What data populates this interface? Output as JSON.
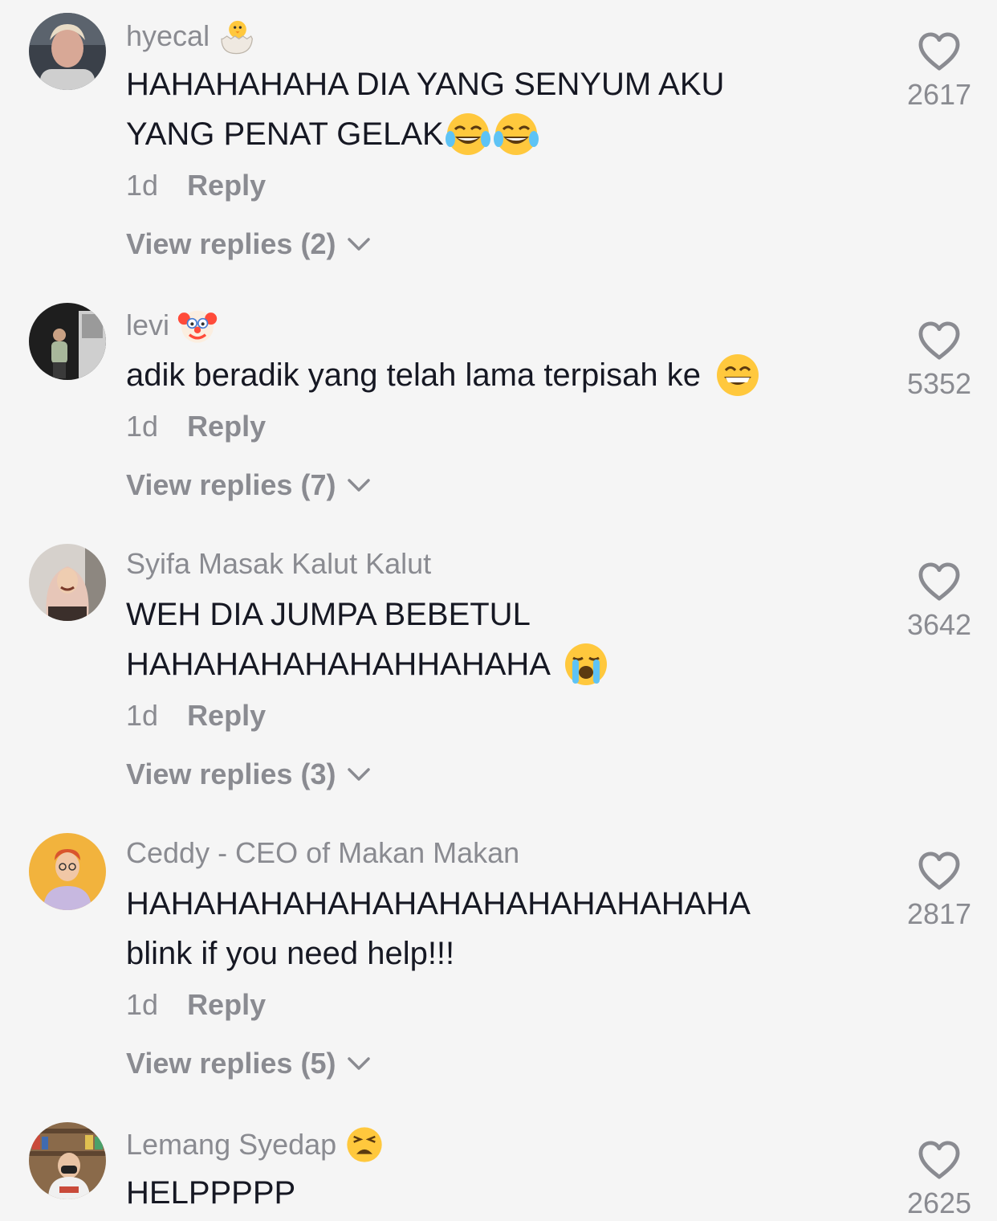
{
  "comments": [
    {
      "username": "hyecal",
      "username_emoji": "hatching-chick-emoji",
      "lines": [
        "HAHAHAHAHA DIA YANG SENYUM AKU",
        "YANG PENAT GELAK"
      ],
      "line_emojis": [
        "face-with-tears-of-joy-emoji",
        "face-with-tears-of-joy-emoji"
      ],
      "time": "1d",
      "reply_label": "Reply",
      "view_replies": "View replies (2)",
      "likes": "2617"
    },
    {
      "username": "levi",
      "username_emoji": "clown-face-emoji",
      "lines": [
        "adik beradik yang telah lama terpisah ke"
      ],
      "line_emojis": [
        "grinning-face-with-smiling-eyes-emoji"
      ],
      "time": "1d",
      "reply_label": "Reply",
      "view_replies": "View replies (7)",
      "likes": "5352"
    },
    {
      "username": "Syifa Masak Kalut Kalut",
      "lines": [
        "WEH DIA JUMPA BEBETUL",
        "HAHAHAHAHAHAHHAHAHA"
      ],
      "line_emojis": [
        "loudly-crying-face-emoji"
      ],
      "time": "1d",
      "reply_label": "Reply",
      "view_replies": "View replies (3)",
      "likes": "3642"
    },
    {
      "username": "Ceddy - CEO of Makan Makan",
      "lines": [
        "HAHAHAHAHAHAHAHAHAHAHAHAHAHA",
        "blink if you need help!!!"
      ],
      "time": "1d",
      "reply_label": "Reply",
      "view_replies": "View replies (5)",
      "likes": "2817"
    },
    {
      "username": "Lemang Syedap",
      "username_emoji": "weary-face-emoji",
      "lines": [
        "HELPPPPP"
      ],
      "likes": "2625"
    }
  ],
  "icons": {
    "like": "heart-outline-icon",
    "expand": "chevron-down-icon"
  },
  "colors": {
    "background": "#f5f5f5",
    "primary_text": "#161823",
    "secondary_text": "#8a8b91"
  }
}
